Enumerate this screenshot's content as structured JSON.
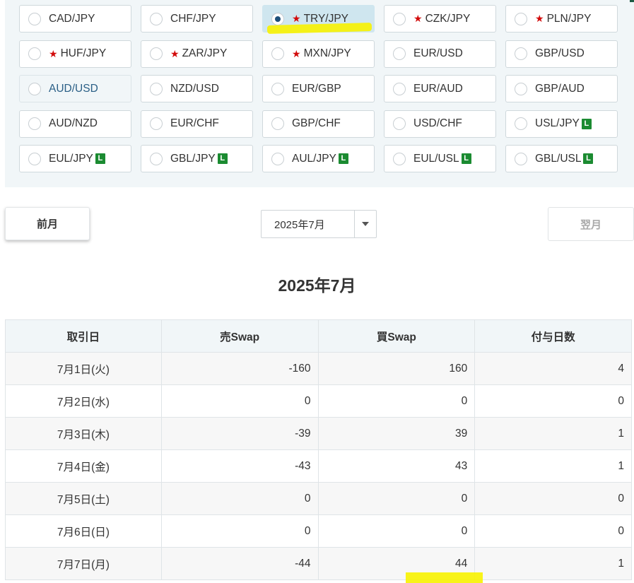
{
  "pairs": [
    {
      "label": "CAD/JPY",
      "star": false,
      "l_badge": false,
      "state": "normal"
    },
    {
      "label": "CHF/JPY",
      "star": false,
      "l_badge": false,
      "state": "normal"
    },
    {
      "label": "TRY/JPY",
      "star": true,
      "l_badge": false,
      "state": "selected"
    },
    {
      "label": "CZK/JPY",
      "star": true,
      "l_badge": false,
      "state": "normal"
    },
    {
      "label": "PLN/JPY",
      "star": true,
      "l_badge": false,
      "state": "normal"
    },
    {
      "label": "HUF/JPY",
      "star": true,
      "l_badge": false,
      "state": "normal"
    },
    {
      "label": "ZAR/JPY",
      "star": true,
      "l_badge": false,
      "state": "normal"
    },
    {
      "label": "MXN/JPY",
      "star": true,
      "l_badge": false,
      "state": "normal"
    },
    {
      "label": "EUR/USD",
      "star": false,
      "l_badge": false,
      "state": "normal"
    },
    {
      "label": "GBP/USD",
      "star": false,
      "l_badge": false,
      "state": "normal"
    },
    {
      "label": "AUD/USD",
      "star": false,
      "l_badge": false,
      "state": "hover"
    },
    {
      "label": "NZD/USD",
      "star": false,
      "l_badge": false,
      "state": "normal"
    },
    {
      "label": "EUR/GBP",
      "star": false,
      "l_badge": false,
      "state": "normal"
    },
    {
      "label": "EUR/AUD",
      "star": false,
      "l_badge": false,
      "state": "normal"
    },
    {
      "label": "GBP/AUD",
      "star": false,
      "l_badge": false,
      "state": "normal"
    },
    {
      "label": "AUD/NZD",
      "star": false,
      "l_badge": false,
      "state": "normal"
    },
    {
      "label": "EUR/CHF",
      "star": false,
      "l_badge": false,
      "state": "normal"
    },
    {
      "label": "GBP/CHF",
      "star": false,
      "l_badge": false,
      "state": "normal"
    },
    {
      "label": "USD/CHF",
      "star": false,
      "l_badge": false,
      "state": "normal"
    },
    {
      "label": "USL/JPY",
      "star": false,
      "l_badge": true,
      "state": "normal"
    },
    {
      "label": "EUL/JPY",
      "star": false,
      "l_badge": true,
      "state": "normal"
    },
    {
      "label": "GBL/JPY",
      "star": false,
      "l_badge": true,
      "state": "normal"
    },
    {
      "label": "AUL/JPY",
      "star": false,
      "l_badge": true,
      "state": "normal"
    },
    {
      "label": "EUL/USL",
      "star": false,
      "l_badge": true,
      "state": "normal"
    },
    {
      "label": "GBL/USL",
      "star": false,
      "l_badge": true,
      "state": "normal"
    }
  ],
  "star_glyph": "★",
  "l_badge_text": "L",
  "nav": {
    "prev_label": "前月",
    "next_label": "翌月",
    "month_select_value": "2025年7月"
  },
  "month_title": "2025年7月",
  "table": {
    "headers": [
      "取引日",
      "売Swap",
      "買Swap",
      "付与日数"
    ],
    "rows": [
      [
        "7月1日(火)",
        "-160",
        "160",
        "4"
      ],
      [
        "7月2日(水)",
        "0",
        "0",
        "0"
      ],
      [
        "7月3日(木)",
        "-39",
        "39",
        "1"
      ],
      [
        "7月4日(金)",
        "-43",
        "43",
        "1"
      ],
      [
        "7月5日(土)",
        "0",
        "0",
        "0"
      ],
      [
        "7月6日(日)",
        "0",
        "0",
        "0"
      ],
      [
        "7月7日(月)",
        "-44",
        "44",
        "1"
      ]
    ]
  },
  "colors": {
    "accent_green": "#1b8b31",
    "star_red": "#d20b0b",
    "selected_bg": "#cfe6ef",
    "highlighter_yellow": "#f7f200"
  }
}
